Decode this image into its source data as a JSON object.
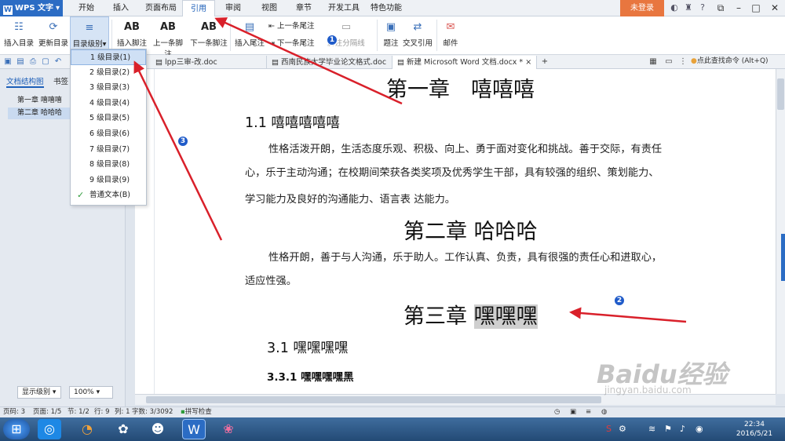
{
  "app": {
    "name": "WPS 文字"
  },
  "menu_tabs": [
    "开始",
    "插入",
    "页面布局",
    "引用",
    "审阅",
    "视图",
    "章节",
    "开发工具",
    "特色功能"
  ],
  "login_label": "未登录",
  "ribbon": {
    "insert_toc": "插入目录",
    "update_toc": "更新目录",
    "toc_level": "目录级别",
    "insert_footnote": "插入脚注",
    "prev_footnote": "上一条脚注",
    "next_footnote": "下一条脚注",
    "insert_endnote": "插入尾注",
    "prev_endnote": "上一条尾注",
    "next_endnote": "下一条尾注",
    "separator": "脚注分隔线",
    "caption": "题注",
    "crossref": "交叉引用",
    "mail": "邮件"
  },
  "doc_tabs": [
    "lpp三审-改.doc",
    "西南民族大学毕业论文格式.doc",
    "新建 Microsoft Word 文档.docx *"
  ],
  "search_placeholder": "点此查找命令 (Alt+Q)",
  "sidebar": {
    "tabs": [
      "文档结构图",
      "书签"
    ],
    "items": [
      "第一章 嘻嘻嘻",
      "第二章 哈哈哈"
    ],
    "level_select": "显示级别",
    "zoom_select": "100%"
  },
  "dropdown": {
    "items": [
      "1 级目录(1)",
      "2 级目录(2)",
      "3 级目录(3)",
      "4 级目录(4)",
      "5 级目录(5)",
      "6 级目录(6)",
      "7 级目录(7)",
      "8 级目录(8)",
      "9 级目录(9)",
      "普通文本(B)"
    ]
  },
  "document": {
    "ch1": "第一章　嘻嘻嘻",
    "h11": "1.1 嘻嘻嘻嘻嘻",
    "p1_line1": "性格活泼开朗，生活态度乐观、积极、向上、勇于面对变化和挑战。善于交际，有责任",
    "p1_line2": "心，乐于主动沟通；在校期间荣获各类奖项及优秀学生干部，具有较强的组织、策划能力、",
    "p1_line3": "学习能力及良好的沟通能力、语言表 达能力。",
    "ch2": "第二章 哈哈哈",
    "p2_line1": "性格开朗，善于与人沟通，乐于助人。工作认真、负责，具有很强的责任心和进取心，",
    "p2_line2": "适应性强。",
    "ch3_prefix": "第三章",
    "ch3_sel": "嘿嘿嘿",
    "h31": "3.1 嘿嘿嘿嘿",
    "h311": "3.3.1 嘿嘿嘿嘿黑"
  },
  "status": {
    "page_no": "页码: 3",
    "pages": "页面: 1/5",
    "section": "节: 1/2",
    "row": "行: 9",
    "col": "列: 1",
    "words": "字数: 3/3092",
    "spell": "拼写检查"
  },
  "clock": {
    "time": "22:34",
    "date": "2016/5/21"
  },
  "badges": [
    "1",
    "2",
    "3"
  ],
  "watermark": {
    "brand": "Baidu经验",
    "url": "jingyan.baidu.com"
  },
  "accent": "#2b6cc4"
}
